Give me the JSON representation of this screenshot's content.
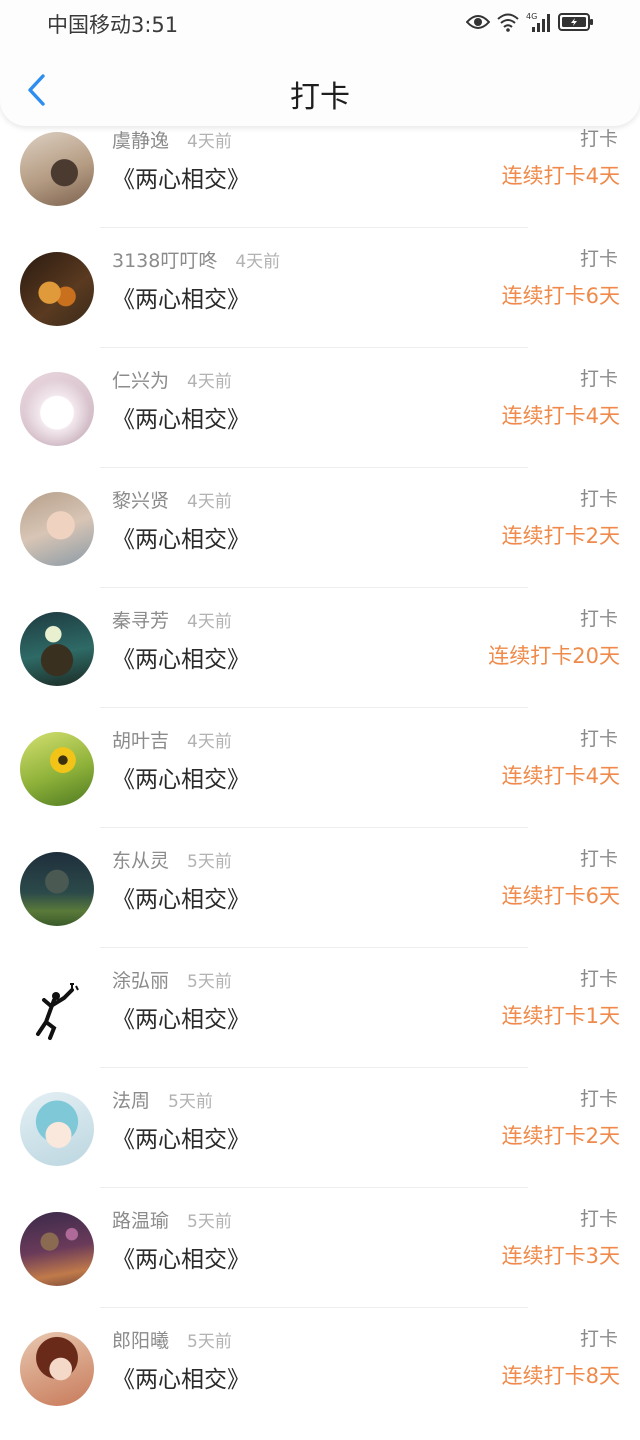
{
  "status_bar": {
    "carrier_time": "中国移动3:51",
    "network": "4G"
  },
  "nav": {
    "back_icon": "chevron-left-icon",
    "title": "打卡"
  },
  "colors": {
    "accent": "#2e8df0",
    "streak": "#ef8a4a"
  },
  "entries": [
    {
      "name": "虞静逸",
      "time": "4天前",
      "book": "《两心相交》",
      "action": "打卡",
      "streak": "连续打卡4天"
    },
    {
      "name": "3138叮叮咚",
      "time": "4天前",
      "book": "《两心相交》",
      "action": "打卡",
      "streak": "连续打卡6天"
    },
    {
      "name": "仁兴为",
      "time": "4天前",
      "book": "《两心相交》",
      "action": "打卡",
      "streak": "连续打卡4天"
    },
    {
      "name": "黎兴贤",
      "time": "4天前",
      "book": "《两心相交》",
      "action": "打卡",
      "streak": "连续打卡2天"
    },
    {
      "name": "秦寻芳",
      "time": "4天前",
      "book": "《两心相交》",
      "action": "打卡",
      "streak": "连续打卡20天"
    },
    {
      "name": "胡叶吉",
      "time": "4天前",
      "book": "《两心相交》",
      "action": "打卡",
      "streak": "连续打卡4天"
    },
    {
      "name": "东从灵",
      "time": "5天前",
      "book": "《两心相交》",
      "action": "打卡",
      "streak": "连续打卡6天"
    },
    {
      "name": "涂弘丽",
      "time": "5天前",
      "book": "《两心相交》",
      "action": "打卡",
      "streak": "连续打卡1天"
    },
    {
      "name": "法周",
      "time": "5天前",
      "book": "《两心相交》",
      "action": "打卡",
      "streak": "连续打卡2天"
    },
    {
      "name": "路温瑜",
      "time": "5天前",
      "book": "《两心相交》",
      "action": "打卡",
      "streak": "连续打卡3天"
    },
    {
      "name": "郎阳曦",
      "time": "5天前",
      "book": "《两心相交》",
      "action": "打卡",
      "streak": "连续打卡8天"
    }
  ]
}
